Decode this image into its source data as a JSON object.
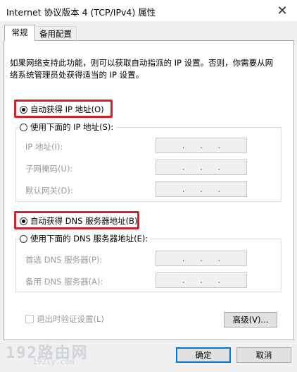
{
  "window": {
    "title": "Internet 协议版本 4 (TCP/IPv4) 属性",
    "close_glyph": "✕"
  },
  "tabs": [
    {
      "label": "常规",
      "active": true
    },
    {
      "label": "备用配置",
      "active": false
    }
  ],
  "description": "如果网络支持此功能，则可以获取自动指派的 IP 设置。否则，你需要从网络系统管理员处获得适当的 IP 设置。",
  "ip_section": {
    "auto_label": "自动获得 IP 地址(O)",
    "auto_selected": true,
    "manual_label": "使用下面的 IP 地址(S):",
    "manual_selected": false,
    "fields": [
      {
        "label": "IP 地址(I):",
        "value": ". . ."
      },
      {
        "label": "子网掩码(U):",
        "value": ". . ."
      },
      {
        "label": "默认网关(D):",
        "value": ". . ."
      }
    ]
  },
  "dns_section": {
    "auto_label": "自动获得 DNS 服务器地址(B)",
    "auto_selected": true,
    "manual_label": "使用下面的 DNS 服务器地址(E):",
    "manual_selected": false,
    "fields": [
      {
        "label": "首选 DNS 服务器(P):",
        "value": ". . ."
      },
      {
        "label": "备用 DNS 服务器(A):",
        "value": ". . ."
      }
    ]
  },
  "validate_checkbox": {
    "label": "退出时验证设置(L)",
    "checked": false,
    "enabled": false
  },
  "buttons": {
    "advanced": "高级(V)...",
    "ok": "确定",
    "cancel": "取消"
  },
  "watermark": {
    "main": "192路由网",
    "sub": "192ly.com"
  },
  "colors": {
    "highlight": "#d31f2b",
    "accent": "#0078d7"
  }
}
